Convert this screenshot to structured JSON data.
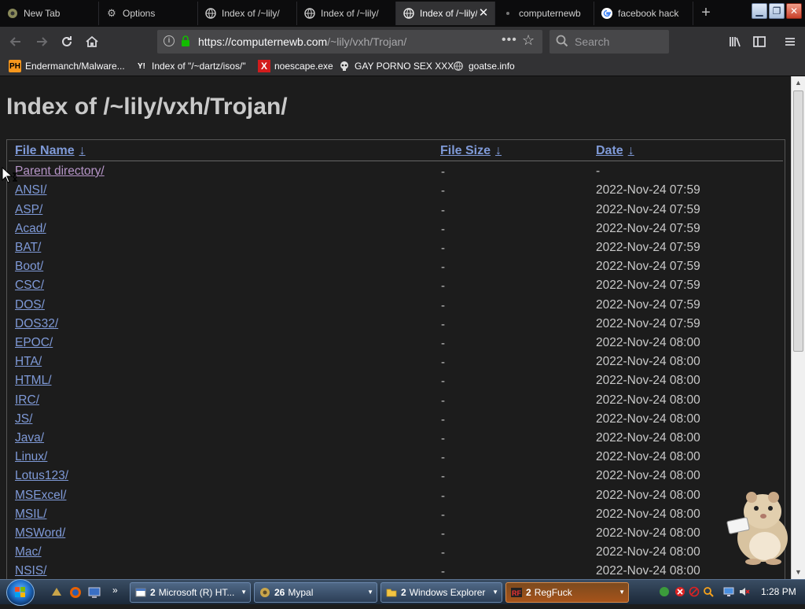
{
  "tabs": [
    {
      "label": "New Tab",
      "icon": "firefox-gear-icon",
      "active": false
    },
    {
      "label": "Options",
      "icon": "gear-icon",
      "active": false
    },
    {
      "label": "Index of /~lily/",
      "icon": "globe-icon",
      "active": false
    },
    {
      "label": "Index of /~lily/",
      "icon": "globe-icon",
      "active": false
    },
    {
      "label": "Index of /~lily/",
      "icon": "globe-icon",
      "active": true
    },
    {
      "label": "computernewb",
      "icon": "dot-icon",
      "active": false
    },
    {
      "label": "facebook hack",
      "icon": "google-icon",
      "active": false
    }
  ],
  "url": {
    "host": "https://computernewb.com",
    "path": "/~lily/vxh/Trojan/"
  },
  "search": {
    "placeholder": "Search"
  },
  "bookmarks": [
    {
      "label": "Endermanch/Malware...",
      "icon": "PH"
    },
    {
      "label": "Index of \"/~dartz/isos/\"",
      "icon": "Y!"
    },
    {
      "label": "noescape.exe",
      "icon": "X"
    },
    {
      "label": "GAY PORNO SEX XXX",
      "icon": "skull"
    },
    {
      "label": "goatse.info",
      "icon": "globe"
    }
  ],
  "page": {
    "title": "Index of /~lily/vxh/Trojan/",
    "columns": [
      {
        "label": "File Name",
        "sort": "↓"
      },
      {
        "label": "File Size",
        "sort": "↓"
      },
      {
        "label": "Date",
        "sort": "↓"
      }
    ],
    "rows": [
      {
        "name": "Parent directory/",
        "size": "-",
        "date": "-"
      },
      {
        "name": "ANSI/",
        "size": "-",
        "date": "2022-Nov-24 07:59"
      },
      {
        "name": "ASP/",
        "size": "-",
        "date": "2022-Nov-24 07:59"
      },
      {
        "name": "Acad/",
        "size": "-",
        "date": "2022-Nov-24 07:59"
      },
      {
        "name": "BAT/",
        "size": "-",
        "date": "2022-Nov-24 07:59"
      },
      {
        "name": "Boot/",
        "size": "-",
        "date": "2022-Nov-24 07:59"
      },
      {
        "name": "CSC/",
        "size": "-",
        "date": "2022-Nov-24 07:59"
      },
      {
        "name": "DOS/",
        "size": "-",
        "date": "2022-Nov-24 07:59"
      },
      {
        "name": "DOS32/",
        "size": "-",
        "date": "2022-Nov-24 07:59"
      },
      {
        "name": "EPOC/",
        "size": "-",
        "date": "2022-Nov-24 08:00"
      },
      {
        "name": "HTA/",
        "size": "-",
        "date": "2022-Nov-24 08:00"
      },
      {
        "name": "HTML/",
        "size": "-",
        "date": "2022-Nov-24 08:00"
      },
      {
        "name": "IRC/",
        "size": "-",
        "date": "2022-Nov-24 08:00"
      },
      {
        "name": "JS/",
        "size": "-",
        "date": "2022-Nov-24 08:00"
      },
      {
        "name": "Java/",
        "size": "-",
        "date": "2022-Nov-24 08:00"
      },
      {
        "name": "Linux/",
        "size": "-",
        "date": "2022-Nov-24 08:00"
      },
      {
        "name": "Lotus123/",
        "size": "-",
        "date": "2022-Nov-24 08:00"
      },
      {
        "name": "MSExcel/",
        "size": "-",
        "date": "2022-Nov-24 08:00"
      },
      {
        "name": "MSIL/",
        "size": "-",
        "date": "2022-Nov-24 08:00"
      },
      {
        "name": "MSWord/",
        "size": "-",
        "date": "2022-Nov-24 08:00"
      },
      {
        "name": "Mac/",
        "size": "-",
        "date": "2022-Nov-24 08:00"
      },
      {
        "name": "NSIS/",
        "size": "-",
        "date": "2022-Nov-24 08:00"
      }
    ]
  },
  "taskbar": {
    "buttons": [
      {
        "count": "2",
        "label": "Microsoft (R) HT...",
        "icon": "window-icon",
        "active": false
      },
      {
        "count": "26",
        "label": "Mypal",
        "icon": "mypal-icon",
        "active": false
      },
      {
        "count": "2",
        "label": "Windows Explorer",
        "icon": "folder-icon",
        "active": false
      },
      {
        "count": "2",
        "label": "RegFuck",
        "icon": "regfuck-icon",
        "active": true
      }
    ],
    "clock": "1:28 PM"
  },
  "colors": {
    "link": "#7f9ad8",
    "visited": "#b695c8",
    "text": "#c9c9c9",
    "background": "#1c1c1c"
  }
}
